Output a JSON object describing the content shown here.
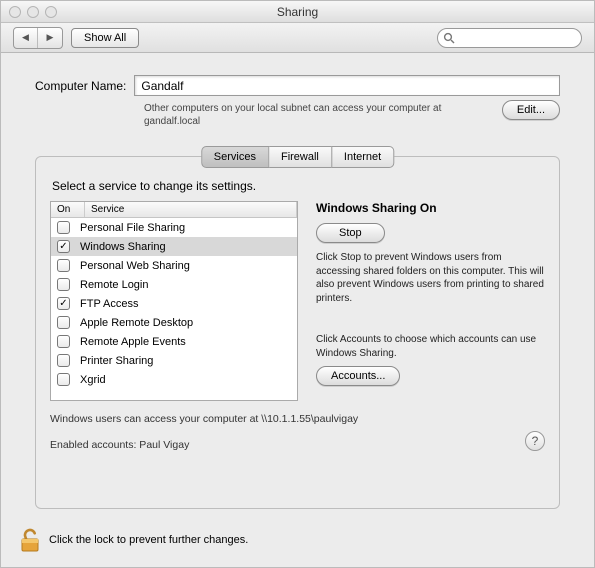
{
  "window": {
    "title": "Sharing"
  },
  "toolbar": {
    "show_all": "Show All",
    "search_placeholder": ""
  },
  "computer_name": {
    "label": "Computer Name:",
    "value": "Gandalf",
    "note": "Other computers on your local subnet can access your computer at gandalf.local",
    "edit": "Edit..."
  },
  "tabs": [
    "Services",
    "Firewall",
    "Internet"
  ],
  "selected_tab": 0,
  "instruction": "Select a service to change its settings.",
  "list": {
    "headers": {
      "on": "On",
      "service": "Service"
    },
    "items": [
      {
        "on": false,
        "name": "Personal File Sharing"
      },
      {
        "on": true,
        "name": "Windows Sharing"
      },
      {
        "on": false,
        "name": "Personal Web Sharing"
      },
      {
        "on": false,
        "name": "Remote Login"
      },
      {
        "on": true,
        "name": "FTP Access"
      },
      {
        "on": false,
        "name": "Apple Remote Desktop"
      },
      {
        "on": false,
        "name": "Remote Apple Events"
      },
      {
        "on": false,
        "name": "Printer Sharing"
      },
      {
        "on": false,
        "name": "Xgrid"
      }
    ],
    "selected_index": 1
  },
  "detail": {
    "title": "Windows Sharing On",
    "stop": "Stop",
    "stop_desc": "Click Stop to prevent Windows users from accessing shared folders on this computer. This will also prevent Windows users from printing to shared printers.",
    "accounts_desc": "Click Accounts to choose which accounts can use Windows Sharing.",
    "accounts": "Accounts..."
  },
  "status": {
    "access": "Windows users can access your computer at \\\\10.1.1.55\\paulvigay",
    "enabled": "Enabled accounts: Paul Vigay"
  },
  "footer": {
    "lock_text": "Click the lock to prevent further changes."
  }
}
